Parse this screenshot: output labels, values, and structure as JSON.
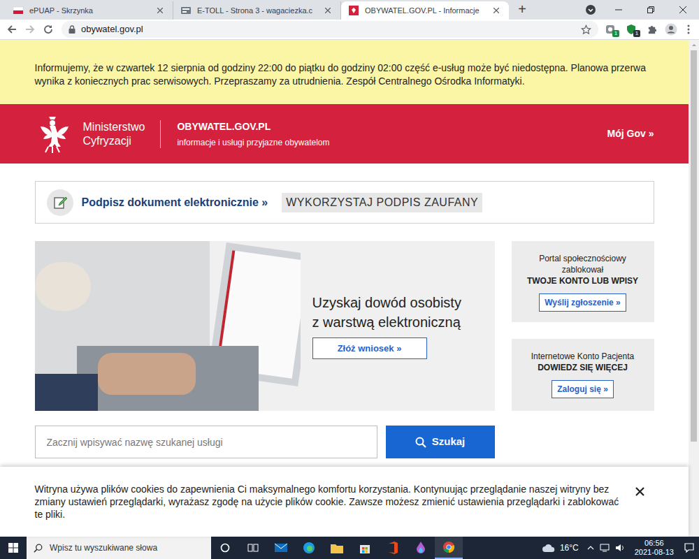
{
  "browser": {
    "tabs": [
      {
        "label": "ePUAP - Skrzynka",
        "selected": false
      },
      {
        "label": "E-TOLL - Strona 3 - wagaciezka.c",
        "selected": false
      },
      {
        "label": "OBYWATEL.GOV.PL - Informacje",
        "selected": true
      }
    ],
    "new_tab": "+",
    "url": "obywatel.gov.pl",
    "extension_badges": [
      "1",
      "1"
    ]
  },
  "notice": "Informujemy, że w czwartek 12 sierpnia od godziny 22:00 do piątku do godziny 02:00 część e-usług może być niedostępna. Planowa przerwa wynika z koniecznych prac serwisowych. Przepraszamy za utrudnienia. Zespół Centralnego Ośrodka Informatyki.",
  "header": {
    "ministry": [
      "Ministerstwo",
      "Cyfryzacji"
    ],
    "site": "OBYWATEL.GOV.PL",
    "tagline": "informacje i usługi przyjazne obywatelom",
    "account": "Mój Gov »"
  },
  "sign": {
    "link": "Podpisz dokument elektronicznie »",
    "tag": "WYKORZYSTAJ PODPIS ZAUFANY"
  },
  "hero": {
    "title": [
      "Uzyskaj dowód osobisty",
      "z warstwą elektroniczną"
    ],
    "button": "Złóż wniosek »"
  },
  "cards": [
    {
      "lines": [
        "Portal społecznościowy",
        "zablokował"
      ],
      "strong": "TWOJE KONTO LUB WPISY",
      "button": "Wyślij zgłoszenie »"
    },
    {
      "lines": [
        "Internetowe Konto Pacjenta"
      ],
      "strong": "DOWIEDZ SIĘ WIĘCEJ",
      "button": "Zaloguj się »"
    }
  ],
  "search": {
    "placeholder": "Zacznij wpisywać nazwę szukanej usługi",
    "button": "Szukaj"
  },
  "cookies": {
    "text": "Witryna używa plików cookies do zapewnienia Ci maksymalnego komfortu korzystania. Kontynuując przeglądanie naszej witryny bez zmiany ustawień przeglądarki, wyrażasz zgodę na użycie plików cookie. Zawsze możesz zmienić ustawienia przeglądarki i zablokować te pliki."
  },
  "taskbar": {
    "search_placeholder": "Wpisz tu wyszukiwane słowa",
    "temperature": "16°C",
    "time": "06:56",
    "date": "2021-08-13"
  }
}
